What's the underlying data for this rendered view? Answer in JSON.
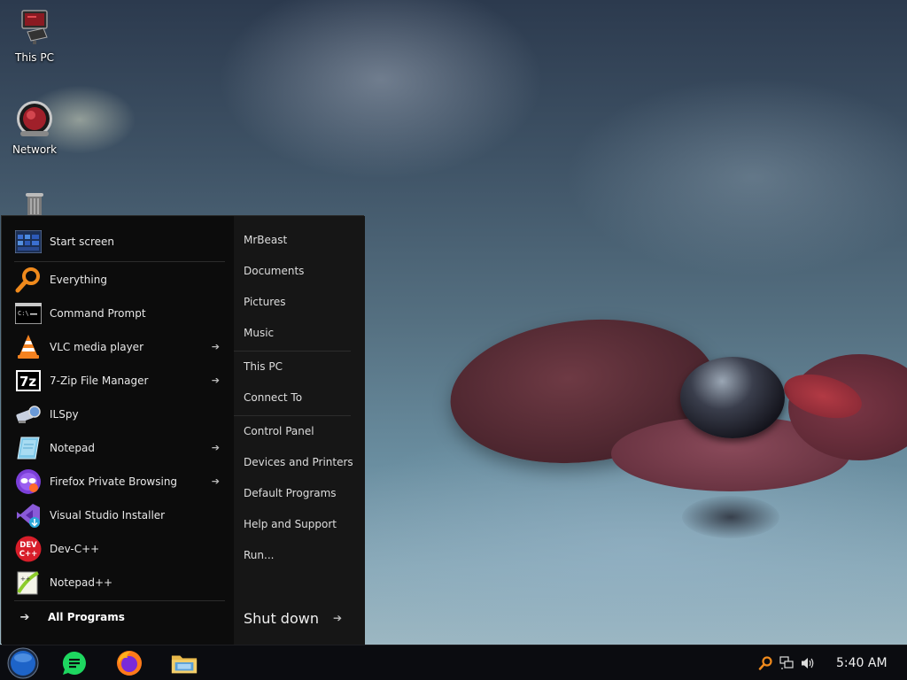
{
  "desktop": {
    "icons": [
      {
        "label": "This PC",
        "icon": "monitor-icon"
      },
      {
        "label": "Network",
        "icon": "network-globe-icon"
      },
      {
        "label": "",
        "icon": "recycle-bin-icon"
      }
    ]
  },
  "start_menu": {
    "left_items": [
      {
        "label": "Start screen",
        "icon": "start-screen-icon",
        "submenu": false
      },
      {
        "label": "Everything",
        "icon": "magnifier-icon",
        "submenu": false
      },
      {
        "label": "Command Prompt",
        "icon": "terminal-icon",
        "submenu": false
      },
      {
        "label": "VLC media player",
        "icon": "vlc-cone-icon",
        "submenu": true
      },
      {
        "label": "7-Zip File Manager",
        "icon": "7zip-icon",
        "submenu": true
      },
      {
        "label": "ILSpy",
        "icon": "ilspy-icon",
        "submenu": false
      },
      {
        "label": "Notepad",
        "icon": "notepad-icon",
        "submenu": true
      },
      {
        "label": "Firefox Private Browsing",
        "icon": "firefox-private-icon",
        "submenu": true
      },
      {
        "label": "Visual Studio Installer",
        "icon": "visual-studio-installer-icon",
        "submenu": false
      },
      {
        "label": "Dev-C++",
        "icon": "devcpp-icon",
        "submenu": false
      },
      {
        "label": "Notepad++",
        "icon": "notepad-plus-plus-icon",
        "submenu": false
      }
    ],
    "all_programs_label": "All Programs",
    "right_items": [
      {
        "label": "MrBeast"
      },
      {
        "label": "Documents"
      },
      {
        "label": "Pictures"
      },
      {
        "label": "Music"
      },
      {
        "label": "This PC"
      },
      {
        "label": "Connect To"
      },
      {
        "label": "Control Panel"
      },
      {
        "label": "Devices and Printers"
      },
      {
        "label": "Default Programs"
      },
      {
        "label": "Help and Support"
      },
      {
        "label": "Run..."
      }
    ],
    "shutdown_label": "Shut down"
  },
  "taskbar": {
    "start_button": "start-orb-icon",
    "pinned": [
      "notes-app-icon",
      "firefox-icon",
      "file-explorer-icon"
    ],
    "tray_icons": [
      "everything-search-tray-icon",
      "network-tray-icon",
      "volume-icon"
    ],
    "clock": "5:40 AM"
  },
  "colors": {
    "menu_bg": "#0c0c0c",
    "menu_right_bg": "#161616",
    "taskbar_bg": "#0b0c10",
    "start_orb": "#1e64c8"
  }
}
